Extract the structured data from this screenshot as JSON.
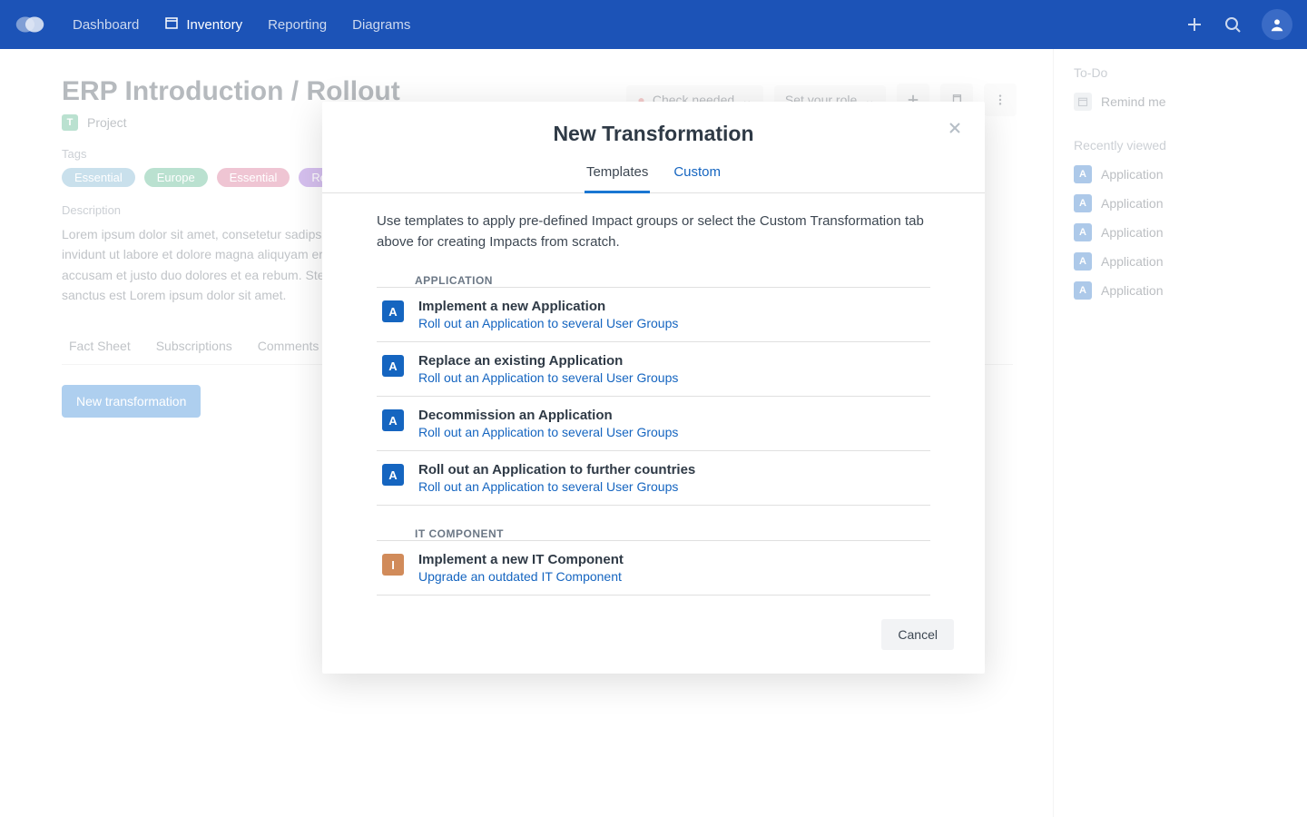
{
  "nav": {
    "items": [
      "Dashboard",
      "Inventory",
      "Reporting",
      "Diagrams"
    ],
    "active_index": 1
  },
  "page": {
    "title": "ERP Introduction / Rollout",
    "type_badge": "T",
    "type_label": "Project",
    "tags_label": "Tags",
    "tags": [
      {
        "text": "Essential",
        "color": "#64a6c8"
      },
      {
        "text": "Europe",
        "color": "#3aa87a"
      },
      {
        "text": "Essential",
        "color": "#d05a82"
      },
      {
        "text": "Re",
        "color": "#8a4bd1"
      }
    ],
    "description_label": "Description",
    "description": "Lorem ipsum dolor sit amet, consetetur sadipscing elitr, sed diam nonumy eirmod tempor invidunt ut labore et dolore magna aliquyam erat, sed diam voluptua. At vero eos et accusam et justo duo dolores et ea rebum. Stet clita kasd gubergren, no sea takimata sanctus est Lorem ipsum dolor sit amet.",
    "fs_tabs": [
      "Fact Sheet",
      "Subscriptions",
      "Comments"
    ],
    "new_transformation_btn": "New transformation"
  },
  "toolbar": {
    "status_label": "Check needed",
    "role_label": "Set your role"
  },
  "sidepanel": {
    "todo_heading": "To-Do",
    "todo_items": [
      "Remind me"
    ],
    "recent_heading": "Recently viewed",
    "recent_items": [
      "Application",
      "Application",
      "Application",
      "Application",
      "Application"
    ]
  },
  "modal": {
    "title": "New Transformation",
    "tabs": {
      "templates": "Templates",
      "custom": "Custom"
    },
    "intro": "Use templates to apply pre-defined Impact groups or select the Custom Transformation tab above for creating Impacts from scratch.",
    "group_application": "APPLICATION",
    "group_itcomponent": "IT COMPONENT",
    "templates_application": [
      {
        "title": "Implement a new Application",
        "sub": "Roll out an Application to several User Groups"
      },
      {
        "title": "Replace an existing Application",
        "sub": "Roll out an Application to several User Groups"
      },
      {
        "title": "Decommission an Application",
        "sub": "Roll out an Application to several User Groups"
      },
      {
        "title": "Roll out an Application to further countries",
        "sub": "Roll out an Application to several User Groups"
      }
    ],
    "templates_itcomponent": [
      {
        "title": "Implement a new IT Component",
        "sub": "Upgrade an outdated IT Component"
      }
    ],
    "cancel": "Cancel",
    "badge_app": "A",
    "badge_it": "I"
  }
}
